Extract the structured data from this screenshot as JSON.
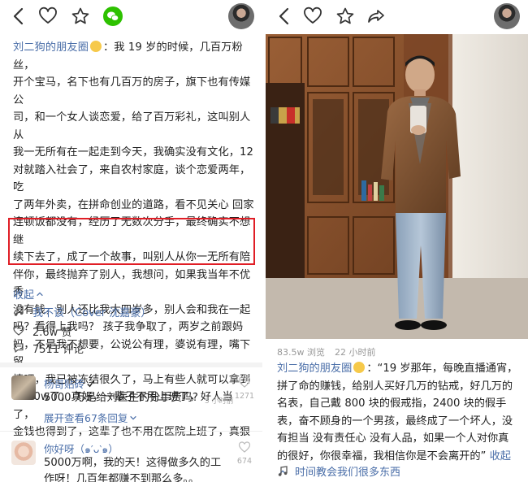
{
  "left_panel": {
    "post": {
      "author": "刘二狗的朋友圈",
      "text_lines": [
        "：我 19 岁的时候，几百万粉丝，",
        "开个宝马，名下也有几百万的房子，旗下也有传媒公",
        "司，和一个女人谈恋爱，给了百万彩礼，这叫别人从",
        "我一无所有在一起走到今天，我确实没有文化，12",
        "对就踏入社会了，来自农村家庭，谈个恋爱两年，吃",
        "了两年外卖，在拼命创业的道路，看不见关心 回家",
        "连顿饭都没有，经历了无数次分手，最终确实不想继",
        "续下去了，成了一个故事，叫别人从你一无所有陪",
        "伴你，最终抛弃了别人，我想问，如果我当年不优秀",
        "没有钱，别人还比我大四岁多，别人会和我在一起",
        "吗？看得上我吗？ 孩子我争取了，两岁之前跟妈",
        "妈，不是我不想要，公说公有理，婆说有理，嘴下留",
        "情吧，我已被冻结很久了，马上有些人就可以拿到",
        "5000w了，真好，一辈子不用上班了，好人当了，",
        "金钱也得到了，这辈子也不用在医院上班了，真狠"
      ],
      "collapse_label": "收起",
      "music": "我不该（Cover 沈嘉豪）",
      "likes": "2.6w 赞",
      "comments": "7511 评论"
    },
    "comment_list": [
      {
        "name": "杨哥贴砖",
        "text": "5000 万是给刘医生的分手费吗?",
        "time": "5 小时前",
        "likes": "1271",
        "expand_label": "展开查看67条回复"
      },
      {
        "name": "你好呀（๑′ᴗ‵๑）",
        "text": "5000万啊，我的天！这得做多久的工作呀！几百年都赚不到那么多。。",
        "likes": "674"
      }
    ]
  },
  "right_panel": {
    "views": "83.5w 浏览",
    "time": "22 小时前",
    "post": {
      "author": "刘二狗的朋友圈",
      "text": "：“19 岁那年，每晚直播通宵，拼了命的赚钱，给别人买好几万的钻戒，好几万的名表，自己戴 800 块的假戒指，2400 块的假手表，奋不顾身的一个男孩，最终成了一个坏人，没有担当 没有责任心 没有人品，如果一个人对你真的很好，你很幸福，我相信你是不会离开的”",
      "collapse_label": "收起",
      "music": "时间教会我们很多东西"
    }
  },
  "icons": [
    "back-arrow-icon",
    "heart-icon",
    "star-icon",
    "wechat-icon",
    "share-icon",
    "music-note-icon",
    "like-icon",
    "comment-icon"
  ],
  "colors": {
    "link_blue": "#4a6ea8",
    "highlight_red": "#e01e26",
    "wechat_green": "#2dc100"
  }
}
